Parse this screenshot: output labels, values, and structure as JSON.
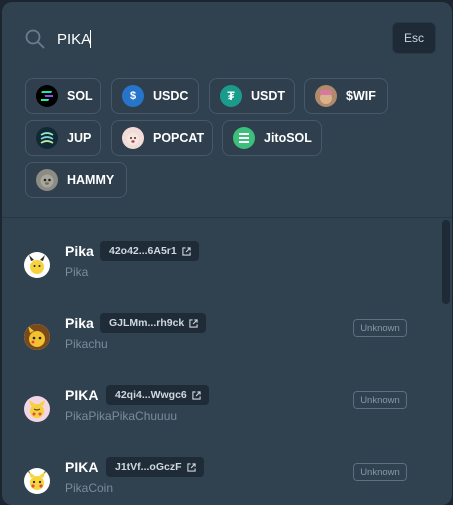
{
  "search": {
    "value": "PIKA",
    "placeholder": "",
    "esc_label": "Esc"
  },
  "chips": [
    {
      "label": "SOL",
      "icon": "sol-token-icon",
      "color": "#000000"
    },
    {
      "label": "USDC",
      "icon": "usdc-token-icon",
      "color": "#2775ca"
    },
    {
      "label": "USDT",
      "icon": "usdt-token-icon",
      "color": "#1a9b8b"
    },
    {
      "label": "$WIF",
      "icon": "wif-token-icon",
      "color": "#b08a6a"
    },
    {
      "label": "JUP",
      "icon": "jup-token-icon",
      "color": "#0f2a35"
    },
    {
      "label": "POPCAT",
      "icon": "popcat-token-icon",
      "color": "#f2dcd8"
    },
    {
      "label": "JitoSOL",
      "icon": "jitosol-token-icon",
      "color": "#3bbf7a"
    },
    {
      "label": "HAMMY",
      "icon": "hammy-token-icon",
      "color": "#8c8c84"
    }
  ],
  "results": [
    {
      "symbol": "Pika",
      "address": "42o42...6A5r1",
      "name": "Pika",
      "badge": ""
    },
    {
      "symbol": "Pika",
      "address": "GJLMm...rh9ck",
      "name": "Pikachu",
      "badge": "Unknown"
    },
    {
      "symbol": "PIKA",
      "address": "42qi4...Wwgc6",
      "name": "PikaPikaPikaChuuuu",
      "badge": "Unknown"
    },
    {
      "symbol": "PIKA",
      "address": "J1tVf...oGczF",
      "name": "PikaCoin",
      "badge": "Unknown"
    }
  ]
}
